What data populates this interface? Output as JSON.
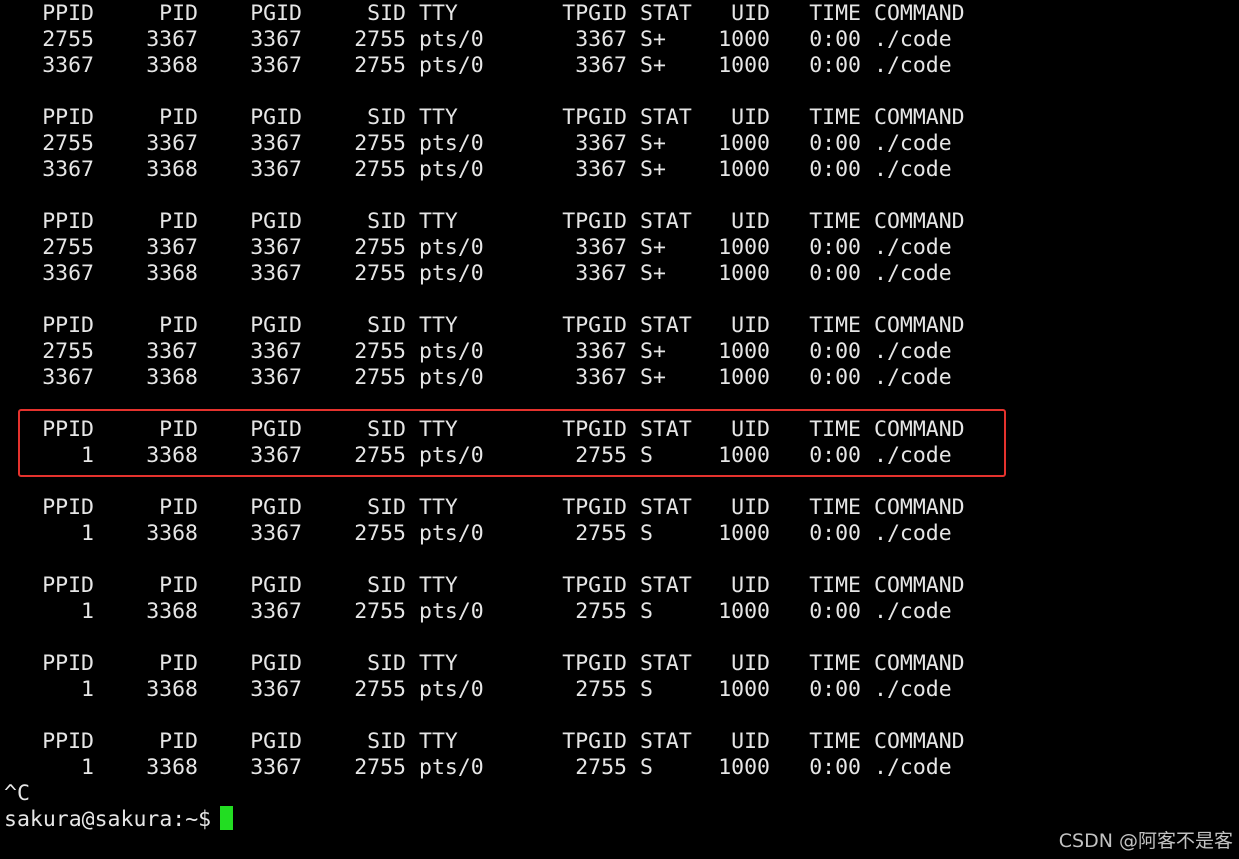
{
  "terminal": {
    "header": [
      "PPID",
      "PID",
      "PGID",
      "SID",
      "TTY",
      "TPGID",
      "STAT",
      "UID",
      "TIME",
      "COMMAND"
    ],
    "blocks": [
      {
        "rows": [
          [
            "2755",
            "3367",
            "3367",
            "2755",
            "pts/0",
            "3367",
            "S+",
            "1000",
            "0:00",
            "./code"
          ],
          [
            "3367",
            "3368",
            "3367",
            "2755",
            "pts/0",
            "3367",
            "S+",
            "1000",
            "0:00",
            "./code"
          ]
        ]
      },
      {
        "rows": [
          [
            "2755",
            "3367",
            "3367",
            "2755",
            "pts/0",
            "3367",
            "S+",
            "1000",
            "0:00",
            "./code"
          ],
          [
            "3367",
            "3368",
            "3367",
            "2755",
            "pts/0",
            "3367",
            "S+",
            "1000",
            "0:00",
            "./code"
          ]
        ]
      },
      {
        "rows": [
          [
            "2755",
            "3367",
            "3367",
            "2755",
            "pts/0",
            "3367",
            "S+",
            "1000",
            "0:00",
            "./code"
          ],
          [
            "3367",
            "3368",
            "3367",
            "2755",
            "pts/0",
            "3367",
            "S+",
            "1000",
            "0:00",
            "./code"
          ]
        ]
      },
      {
        "rows": [
          [
            "2755",
            "3367",
            "3367",
            "2755",
            "pts/0",
            "3367",
            "S+",
            "1000",
            "0:00",
            "./code"
          ],
          [
            "3367",
            "3368",
            "3367",
            "2755",
            "pts/0",
            "3367",
            "S+",
            "1000",
            "0:00",
            "./code"
          ]
        ]
      },
      {
        "highlighted": true,
        "rows": [
          [
            "1",
            "3368",
            "3367",
            "2755",
            "pts/0",
            "2755",
            "S",
            "1000",
            "0:00",
            "./code"
          ]
        ]
      },
      {
        "rows": [
          [
            "1",
            "3368",
            "3367",
            "2755",
            "pts/0",
            "2755",
            "S",
            "1000",
            "0:00",
            "./code"
          ]
        ]
      },
      {
        "rows": [
          [
            "1",
            "3368",
            "3367",
            "2755",
            "pts/0",
            "2755",
            "S",
            "1000",
            "0:00",
            "./code"
          ]
        ]
      },
      {
        "rows": [
          [
            "1",
            "3368",
            "3367",
            "2755",
            "pts/0",
            "2755",
            "S",
            "1000",
            "0:00",
            "./code"
          ]
        ]
      },
      {
        "rows": [
          [
            "1",
            "3368",
            "3367",
            "2755",
            "pts/0",
            "2755",
            "S",
            "1000",
            "0:00",
            "./code"
          ]
        ]
      }
    ],
    "interrupt": "^C",
    "prompt": "sakura@sakura:~$",
    "highlight_color": "#e5322d",
    "cursor_color": "#22dd22",
    "background": "#000000",
    "foreground": "#e6e6e6"
  },
  "watermark": {
    "text": "CSDN @阿客不是客"
  }
}
